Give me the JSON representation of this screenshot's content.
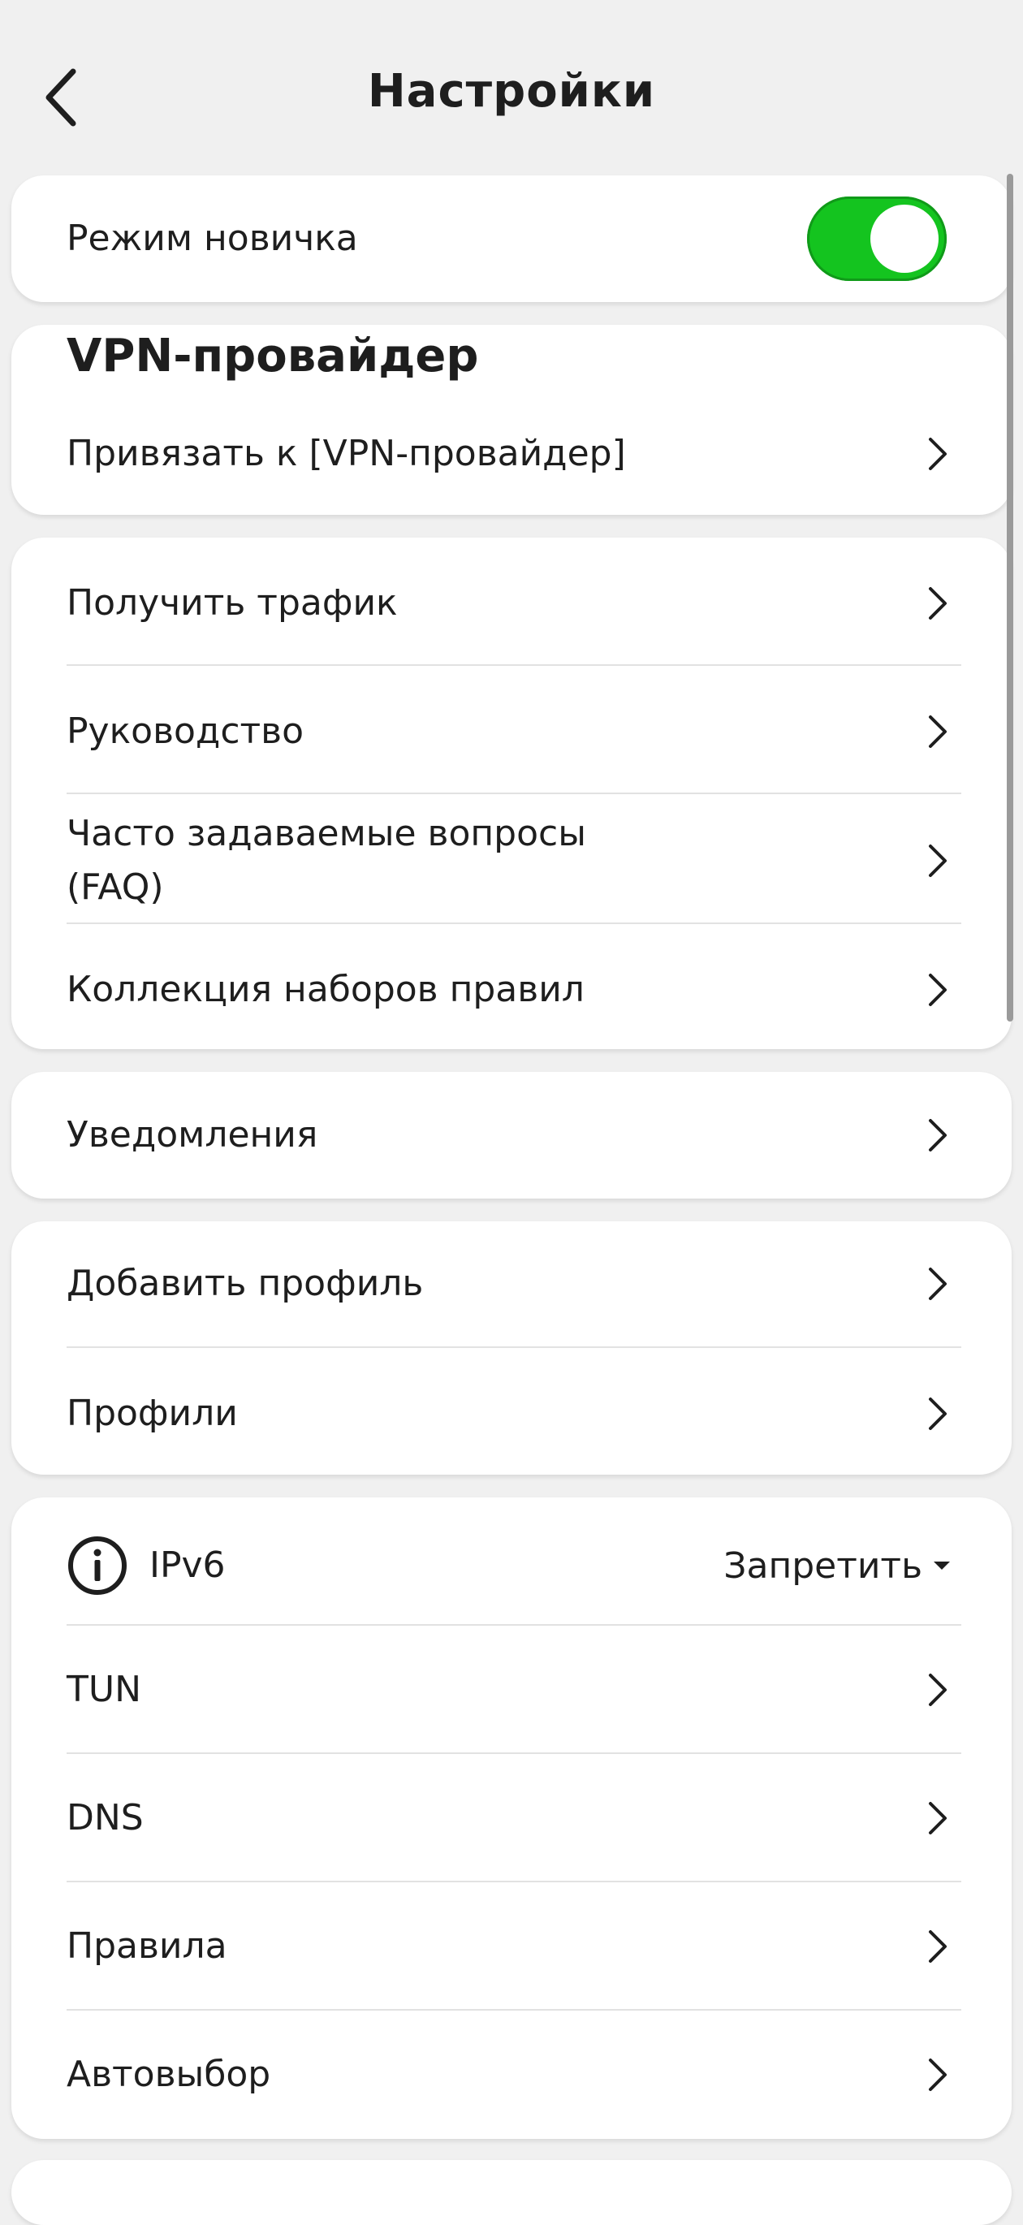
{
  "header": {
    "title": "Настройки",
    "back_icon": "chevron-left-icon"
  },
  "beginner_mode": {
    "label": "Режим новичка",
    "enabled": true,
    "toggle_color": "#14c41f"
  },
  "vpn_provider": {
    "title": "VPN-провайдер",
    "bind_label": "Привязать к [VPN-провайдер]"
  },
  "help": {
    "items": [
      {
        "label": "Получить трафик"
      },
      {
        "label": "Руководство"
      },
      {
        "label": "Часто задаваемые вопросы (FAQ)"
      },
      {
        "label": "Коллекция наборов правил"
      }
    ]
  },
  "notifications": {
    "label": "Уведомления"
  },
  "profiles": {
    "items": [
      {
        "label": "Добавить профиль"
      },
      {
        "label": "Профили"
      }
    ]
  },
  "network": {
    "ipv6": {
      "icon": "info-icon",
      "label": "IPv6",
      "value": "Запретить"
    },
    "items": [
      {
        "label": "TUN"
      },
      {
        "label": "DNS"
      },
      {
        "label": "Правила"
      },
      {
        "label": "Автовыбор"
      }
    ]
  }
}
